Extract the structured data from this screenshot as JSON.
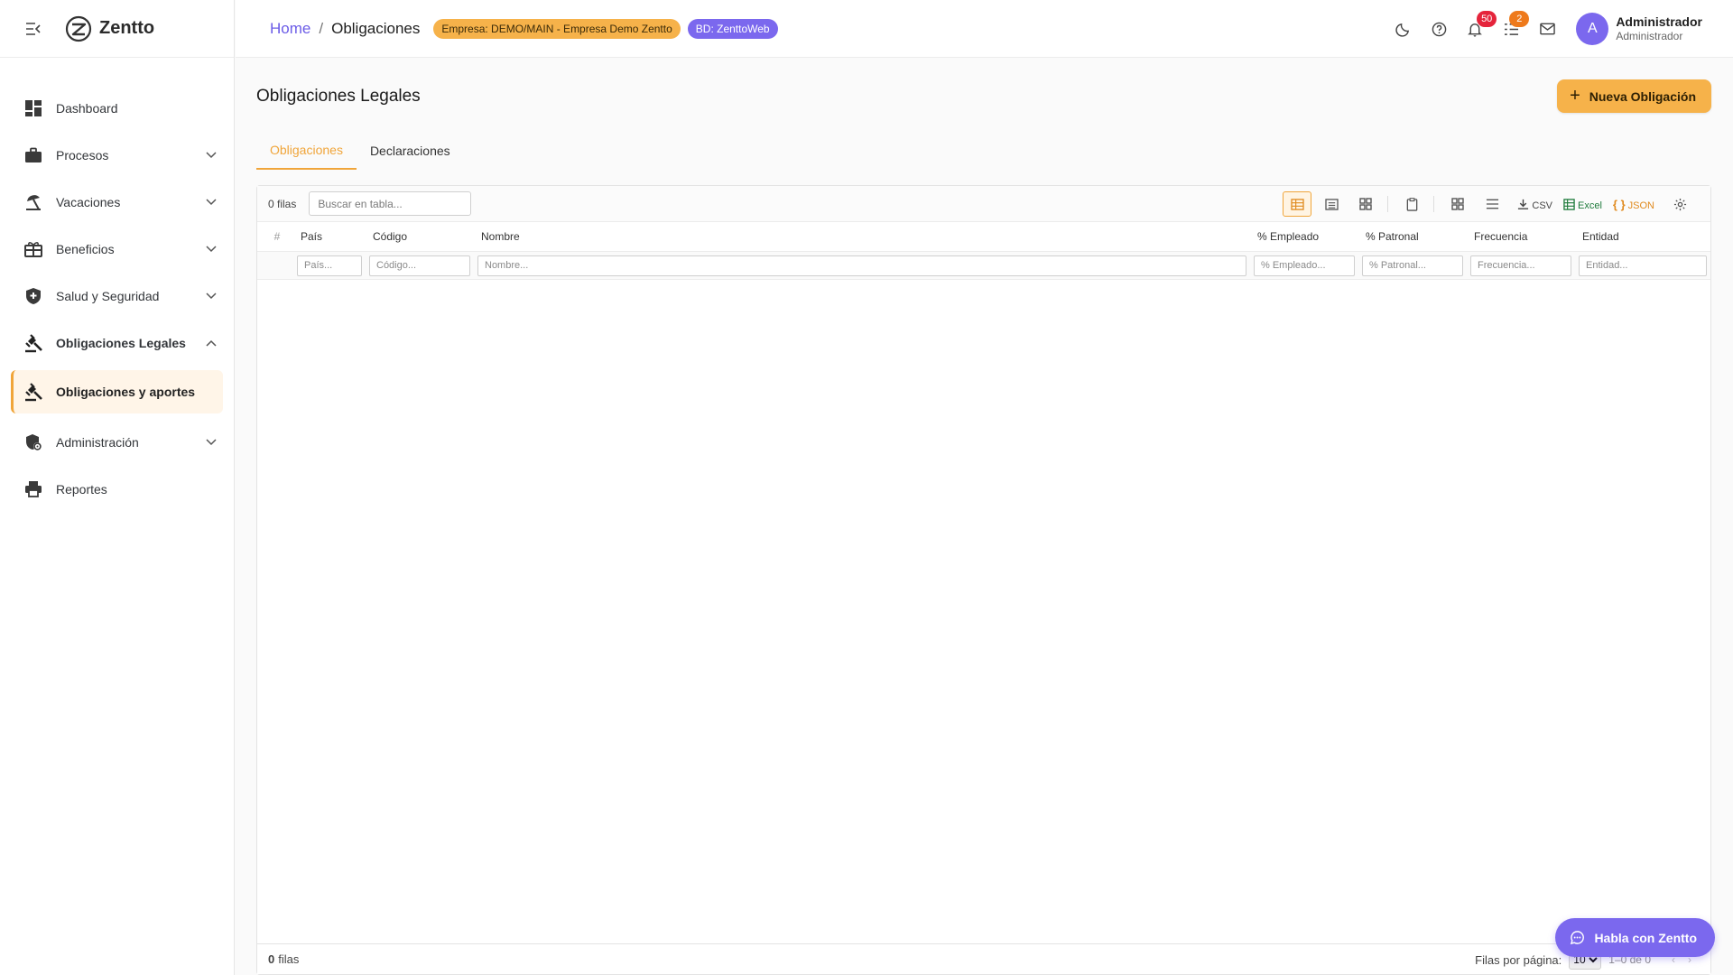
{
  "brand": {
    "name": "Zentto"
  },
  "sidebar": {
    "items": [
      {
        "label": "Dashboard",
        "icon": "dashboard-icon",
        "expandable": false
      },
      {
        "label": "Procesos",
        "icon": "briefcase-icon",
        "expandable": true
      },
      {
        "label": "Vacaciones",
        "icon": "beach-icon",
        "expandable": true
      },
      {
        "label": "Beneficios",
        "icon": "gift-icon",
        "expandable": true
      },
      {
        "label": "Salud y Seguridad",
        "icon": "shield-icon",
        "expandable": true
      },
      {
        "label": "Obligaciones Legales",
        "icon": "gavel-icon",
        "expandable": true,
        "open": true
      },
      {
        "label": "Administración",
        "icon": "admin-icon",
        "expandable": true
      },
      {
        "label": "Reportes",
        "icon": "printer-icon",
        "expandable": false
      }
    ],
    "active_sub": {
      "label": "Obligaciones y aportes",
      "icon": "gavel-icon"
    }
  },
  "header": {
    "breadcrumb_home": "Home",
    "breadcrumb_sep": "/",
    "breadcrumb_current": "Obligaciones",
    "company_badge": "Empresa: DEMO/MAIN - Empresa Demo Zentto",
    "db_badge": "BD: ZenttoWeb",
    "notifications_count": "50",
    "tasks_count": "2",
    "avatar_letter": "A",
    "user_name": "Administrador",
    "user_role": "Administrador"
  },
  "page": {
    "title": "Obligaciones Legales",
    "new_button": "Nueva Obligación",
    "tabs": [
      {
        "label": "Obligaciones",
        "active": true
      },
      {
        "label": "Declaraciones",
        "active": false
      }
    ]
  },
  "table": {
    "row_count_label": "0 filas",
    "search_placeholder": "Buscar en tabla...",
    "toolbar": {
      "csv": "CSV",
      "excel": "Excel",
      "json": "JSON"
    },
    "hash": "#",
    "columns": [
      {
        "label": "País",
        "filter": "País..."
      },
      {
        "label": "Código",
        "filter": "Código..."
      },
      {
        "label": "Nombre",
        "filter": "Nombre..."
      },
      {
        "label": "% Empleado",
        "filter": "% Empleado..."
      },
      {
        "label": "% Patronal",
        "filter": "% Patronal..."
      },
      {
        "label": "Frecuencia",
        "filter": "Frecuencia..."
      },
      {
        "label": "Entidad",
        "filter": "Entidad..."
      }
    ],
    "rows": [],
    "footer": {
      "count": "0",
      "count_suffix": "filas",
      "rows_per_page_label": "Filas por página:",
      "rows_per_page": "10",
      "range": "1–0 de 0",
      "prev": "‹",
      "next": "›"
    }
  },
  "chat": {
    "label": "Habla con Zentto"
  },
  "colors": {
    "accent": "#f0a53a",
    "primary": "#7b68ee",
    "danger": "#e5243b",
    "excel": "#1d7a3a"
  }
}
